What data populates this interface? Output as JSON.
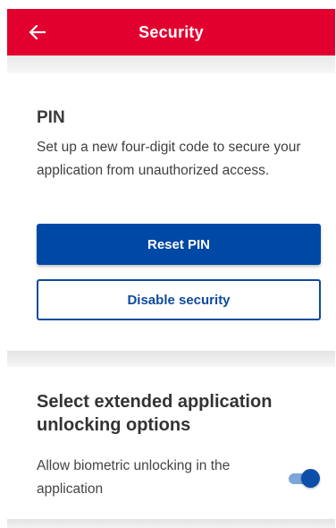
{
  "header": {
    "title": "Security",
    "back_icon": "arrow-left-icon",
    "color": "#e2002f"
  },
  "pin": {
    "title": "PIN",
    "description": "Set up a new four-digit code to secure your application from unauthorized access.",
    "reset_label": "Reset PIN",
    "disable_label": "Disable security",
    "primary_color": "#0048a5"
  },
  "unlock": {
    "title": "Select extended application unlocking options",
    "biometric_label": "Allow biometric unlocking in the application",
    "biometric_enabled": true
  }
}
